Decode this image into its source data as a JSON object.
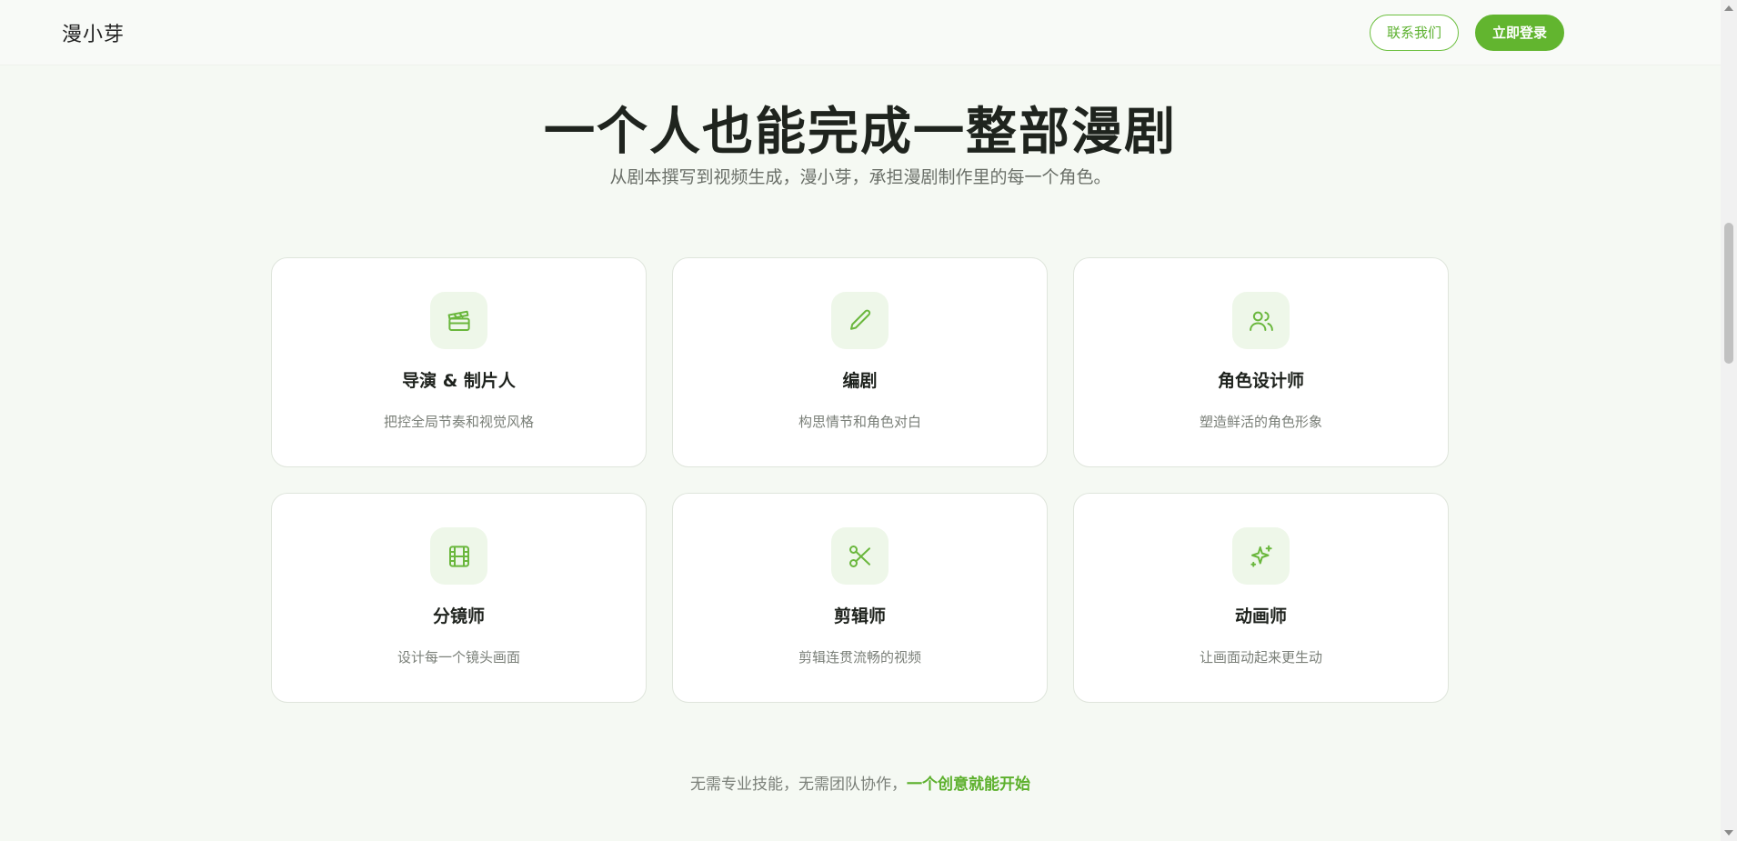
{
  "header": {
    "brand": "漫小芽",
    "contact_label": "联系我们",
    "login_label": "立即登录"
  },
  "hero": {
    "title": "一个人也能完成一整部漫剧",
    "subtitle": "从剧本撰写到视频生成，漫小芽，承担漫剧制作里的每一个角色。"
  },
  "roles": [
    {
      "title": "导演 & 制片人",
      "desc": "把控全局节奏和视觉风格",
      "icon": "clapperboard-icon"
    },
    {
      "title": "编剧",
      "desc": "构思情节和角色对白",
      "icon": "pencil-icon"
    },
    {
      "title": "角色设计师",
      "desc": "塑造鲜活的角色形象",
      "icon": "users-icon"
    },
    {
      "title": "分镜师",
      "desc": "设计每一个镜头画面",
      "icon": "film-icon"
    },
    {
      "title": "剪辑师",
      "desc": "剪辑连贯流畅的视频",
      "icon": "scissors-icon"
    },
    {
      "title": "动画师",
      "desc": "让画面动起来更生动",
      "icon": "sparkles-icon"
    }
  ],
  "footer": {
    "text": "无需专业技能，无需团队协作，",
    "highlight": "一个创意就能开始"
  },
  "colors": {
    "accent": "#62b52f",
    "background": "#f5f9f3",
    "icon_bg": "#eef7e9"
  }
}
